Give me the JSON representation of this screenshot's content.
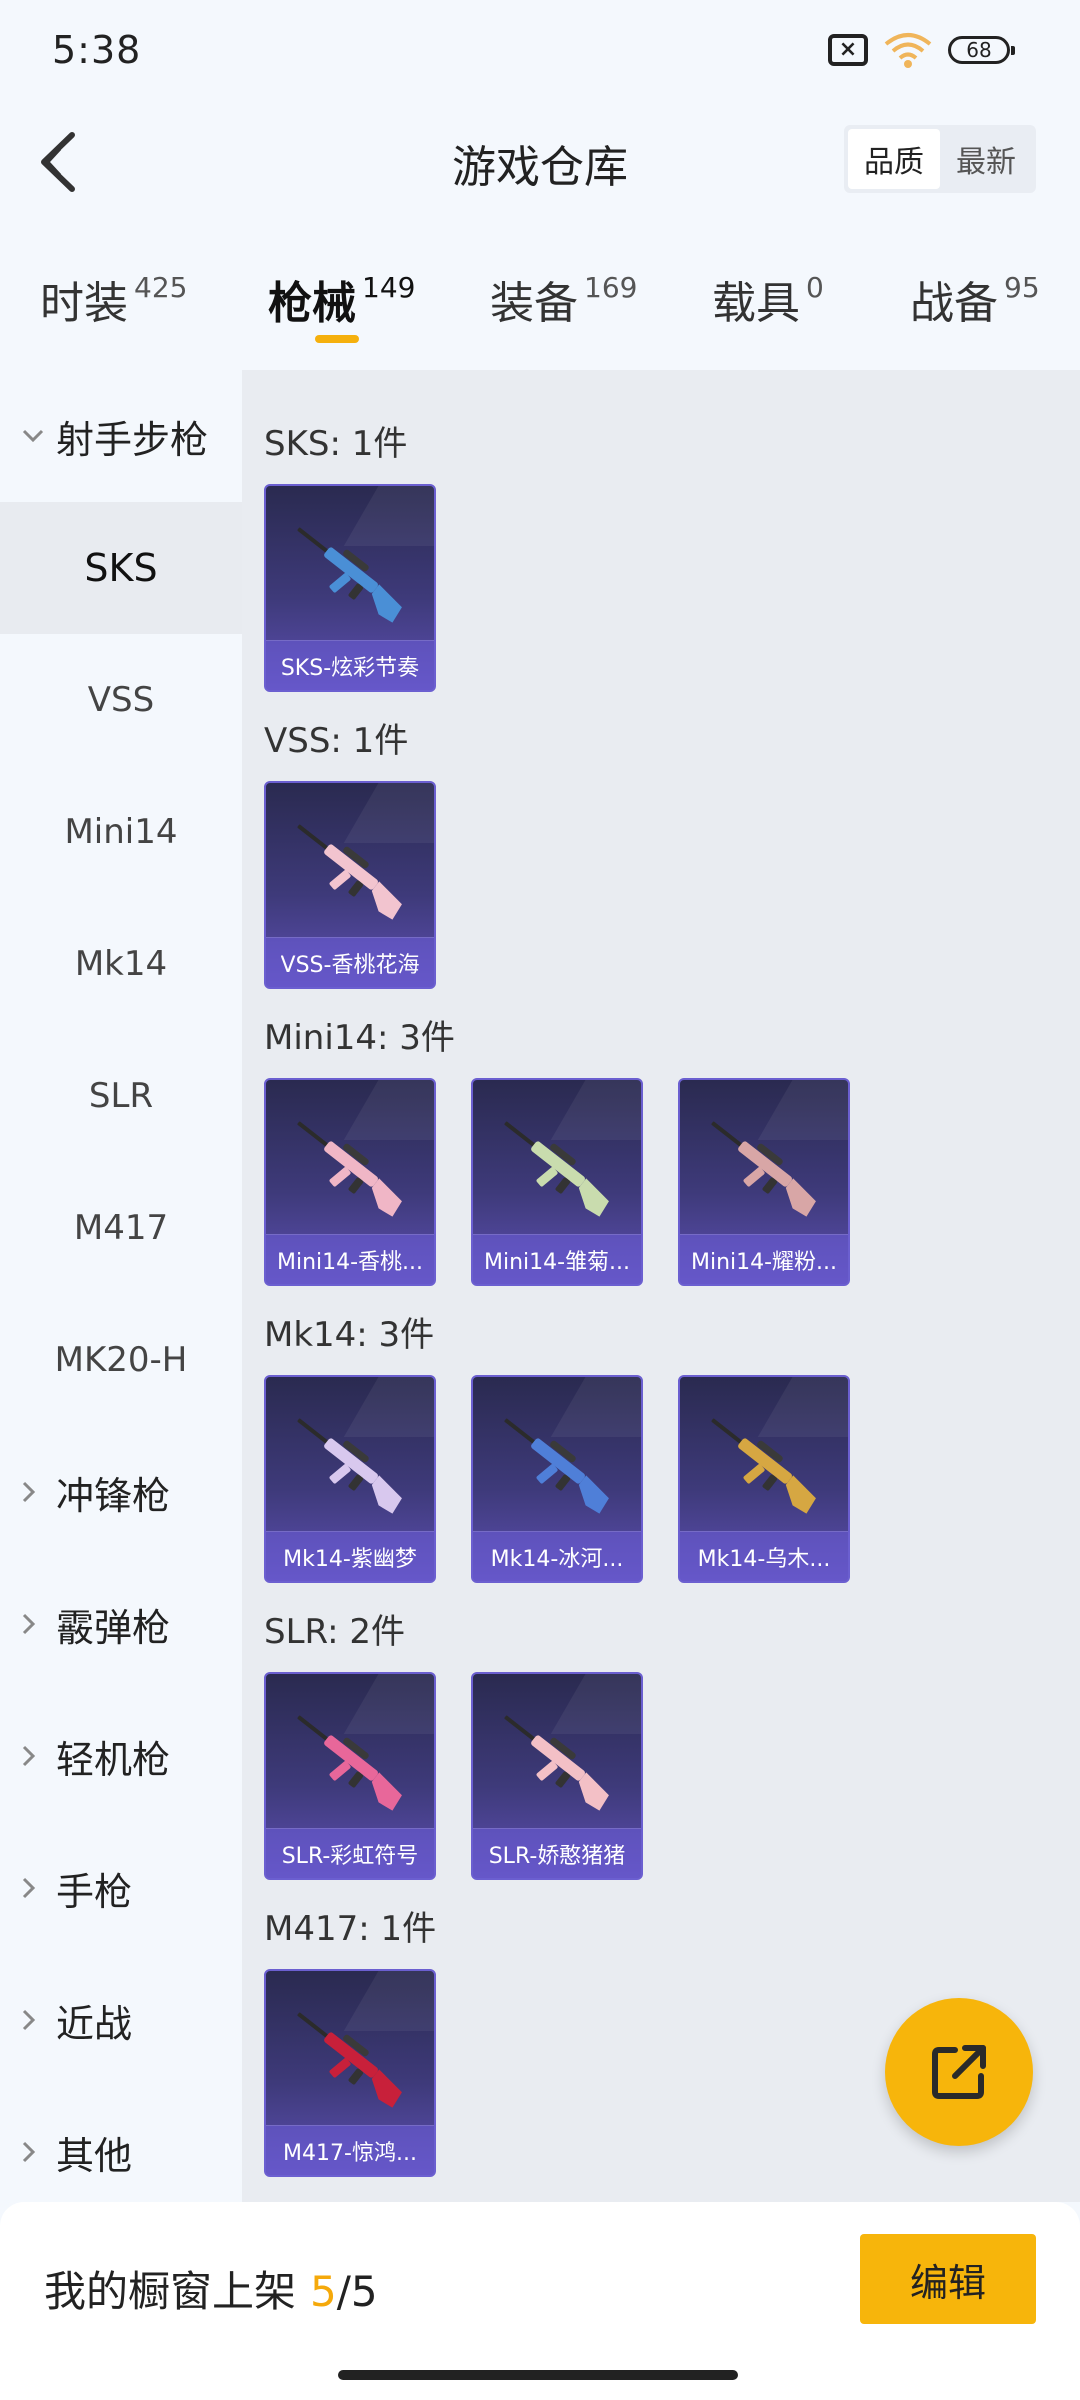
{
  "status": {
    "time": "5:38",
    "battery": "68"
  },
  "header": {
    "title": "游戏仓库",
    "sort_options": [
      "品质",
      "最新"
    ]
  },
  "category_tabs": [
    {
      "label": "时装",
      "count": "425"
    },
    {
      "label": "枪械",
      "count": "149"
    },
    {
      "label": "装备",
      "count": "169"
    },
    {
      "label": "载具",
      "count": "0"
    },
    {
      "label": "战备",
      "count": "95"
    }
  ],
  "sidebar": {
    "expanded_group": "射手步枪",
    "sub_items": [
      "SKS",
      "VSS",
      "Mini14",
      "Mk14",
      "SLR",
      "M417",
      "MK20-H"
    ],
    "active_item": "SKS",
    "collapsed_groups": [
      "冲锋枪",
      "霰弹枪",
      "轻机枪",
      "手枪",
      "近战",
      "其他"
    ]
  },
  "sections": [
    {
      "title": "SKS: 1件",
      "items": [
        "SKS-炫彩节奏"
      ]
    },
    {
      "title": "VSS: 1件",
      "items": [
        "VSS-香桃花海"
      ]
    },
    {
      "title": "Mini14: 3件",
      "items": [
        "Mini14-香桃...",
        "Mini14-雏菊...",
        "Mini14-耀粉..."
      ]
    },
    {
      "title": "Mk14: 3件",
      "items": [
        "Mk14-紫幽梦",
        "Mk14-冰河...",
        "Mk14-乌木..."
      ]
    },
    {
      "title": "SLR: 2件",
      "items": [
        "SLR-彩虹符号",
        "SLR-娇憨猪猪"
      ]
    },
    {
      "title": "M417: 1件",
      "items": [
        "M417-惊鸿..."
      ]
    }
  ],
  "weapon_colors": {
    "sks": "#4a8fd6",
    "vss": "#f2c4cf",
    "mini14_1": "#f0b6c6",
    "mini14_2": "#c9dcae",
    "mini14_3": "#d8a6a6",
    "mk14_1": "#d8c8ee",
    "mk14_2": "#4f7fd8",
    "mk14_3": "#d6a742",
    "slr_1": "#e8679a",
    "slr_2": "#f3c0c6",
    "m417": "#c8203a"
  },
  "bottom": {
    "label": "我的橱窗上架",
    "current": "5",
    "separator": "/",
    "total": "5",
    "edit_label": "编辑"
  },
  "accent": "#f7b50b"
}
